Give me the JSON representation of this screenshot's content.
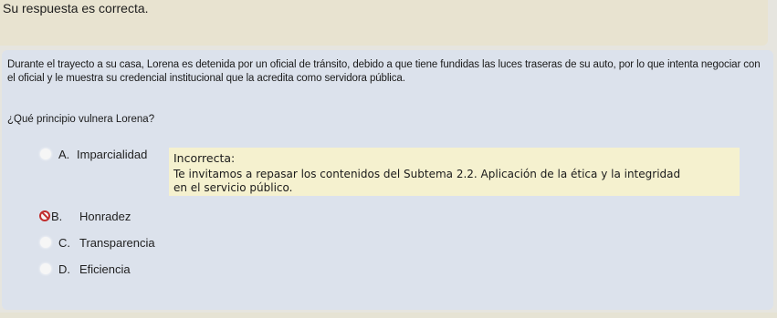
{
  "feedback": {
    "text": "Su respuesta es correcta."
  },
  "question": {
    "text": "Durante el trayecto a su casa, Lorena es detenida por un oficial de tránsito, debido a que tiene fundidas las luces traseras de su auto, por lo que intenta negociar con el oficial y le muestra su credencial institucional que la acredita como servidora pública.",
    "prompt": "¿Qué principio vulnera Lorena?"
  },
  "options": [
    {
      "letter": "A.",
      "label": "Imparcialidad",
      "state": "unselected"
    },
    {
      "letter": "B.",
      "label": "Honradez",
      "state": "selected-incorrect"
    },
    {
      "letter": "C.",
      "label": "Transparencia",
      "state": "unselected"
    },
    {
      "letter": "D.",
      "label": "Eficiencia",
      "state": "unselected"
    }
  ],
  "tooltip": {
    "title": "Incorrecta:",
    "body_line1": "Te invitamos a repasar los contenidos del Subtema 2.2. Aplicación de la ética y la integridad",
    "body_line2": "en el servicio público."
  },
  "colors": {
    "panel": "#dce2ec",
    "banner": "#e8e3d0",
    "tooltip": "#f5f1cf",
    "incorrect": "#c12d2d"
  }
}
